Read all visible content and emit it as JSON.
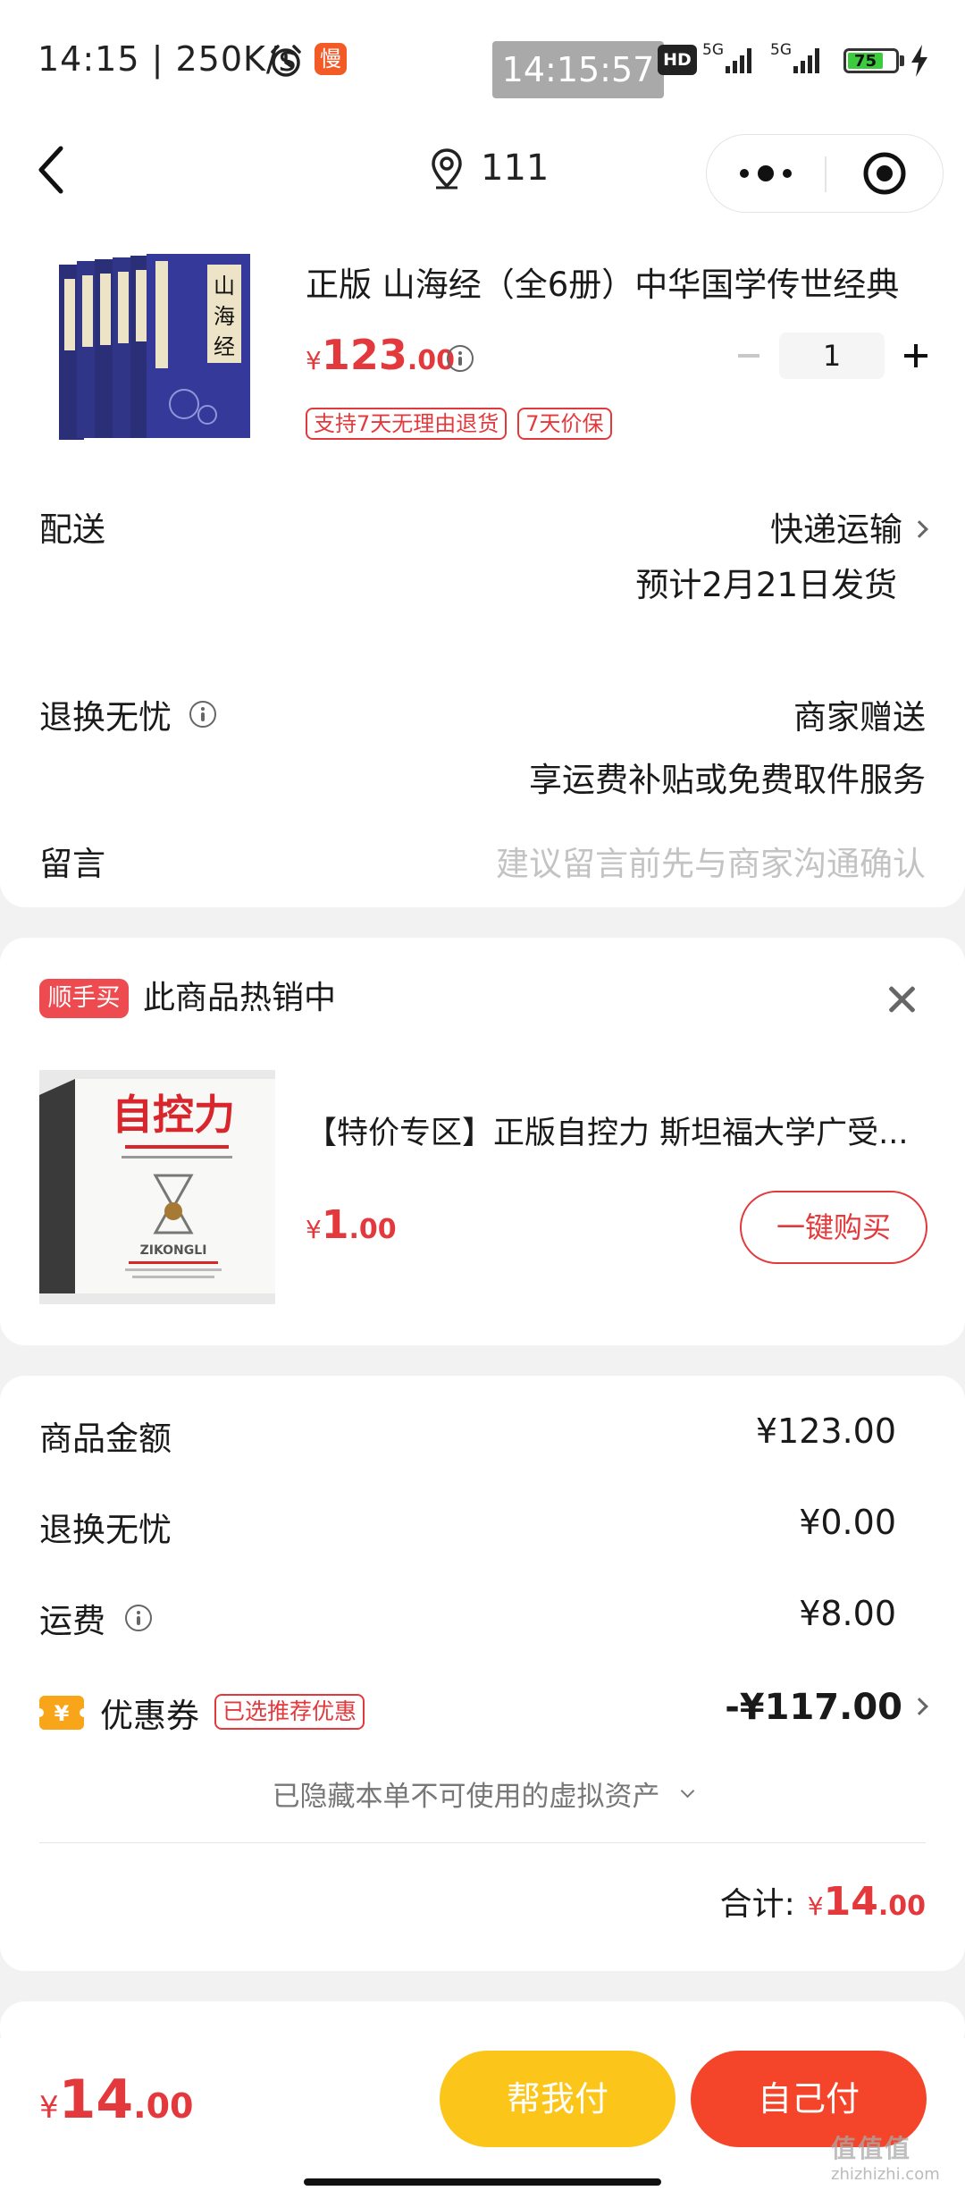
{
  "status_bar": {
    "time": "14:15 | 250K/s",
    "app_badge": "慢",
    "clock_overlay": "14:15:57",
    "hd": "HD",
    "signal1": "5G",
    "signal2": "5G",
    "battery": "75",
    "battery_level": 0.75
  },
  "nav": {
    "location_icon": "location-pin-icon",
    "title": "111"
  },
  "product": {
    "title": "正版 山海经（全6册）中华国学传世经典",
    "cover_text": "山海经",
    "price_symbol": "¥",
    "price_int": "123",
    "price_dec": ".00",
    "quantity": "1",
    "tags": [
      "支持7天无理由退货",
      "7天价保"
    ]
  },
  "delivery": {
    "label": "配送",
    "method": "快递运输",
    "eta": "预计2月21日发货"
  },
  "returns": {
    "label": "退换无忧",
    "value": "商家赠送",
    "desc": "享运费补贴或免费取件服务"
  },
  "message": {
    "label": "留言",
    "placeholder": "建议留言前先与商家沟通确认"
  },
  "recommend": {
    "badge": "顺手买",
    "title": "此商品热销中",
    "item_title": "【特价专区】正版自控力 斯坦福大学广受...",
    "cover_title": "自控力",
    "cover_sub": "ZIKONGLI",
    "price_symbol": "¥",
    "price_int": "1",
    "price_dec": ".00",
    "buy_label": "一键购买"
  },
  "summary": {
    "goods_label": "商品金额",
    "goods_value": "¥123.00",
    "returns_label": "退换无忧",
    "returns_value": "¥0.00",
    "shipping_label": "运费",
    "shipping_value": "¥8.00",
    "coupon_label": "优惠券",
    "coupon_tag": "已选推荐优惠",
    "coupon_value": "-¥117.00",
    "coupon_icon": "¥",
    "hidden_assets": "已隐藏本单不可使用的虚拟资产",
    "total_label": "合计:",
    "total_symbol": "¥",
    "total_int": "14",
    "total_dec": ".00"
  },
  "bottom": {
    "price_symbol": "¥",
    "price_int": "14",
    "price_dec": ".00",
    "help_pay": "帮我付",
    "self_pay": "自己付"
  },
  "watermark": {
    "text": "值值值",
    "url": "zhizhizhi.com"
  },
  "colors": {
    "accent_red": "#e4393c",
    "help_yellow": "#fcc51a",
    "pay_red": "#f4452a"
  }
}
